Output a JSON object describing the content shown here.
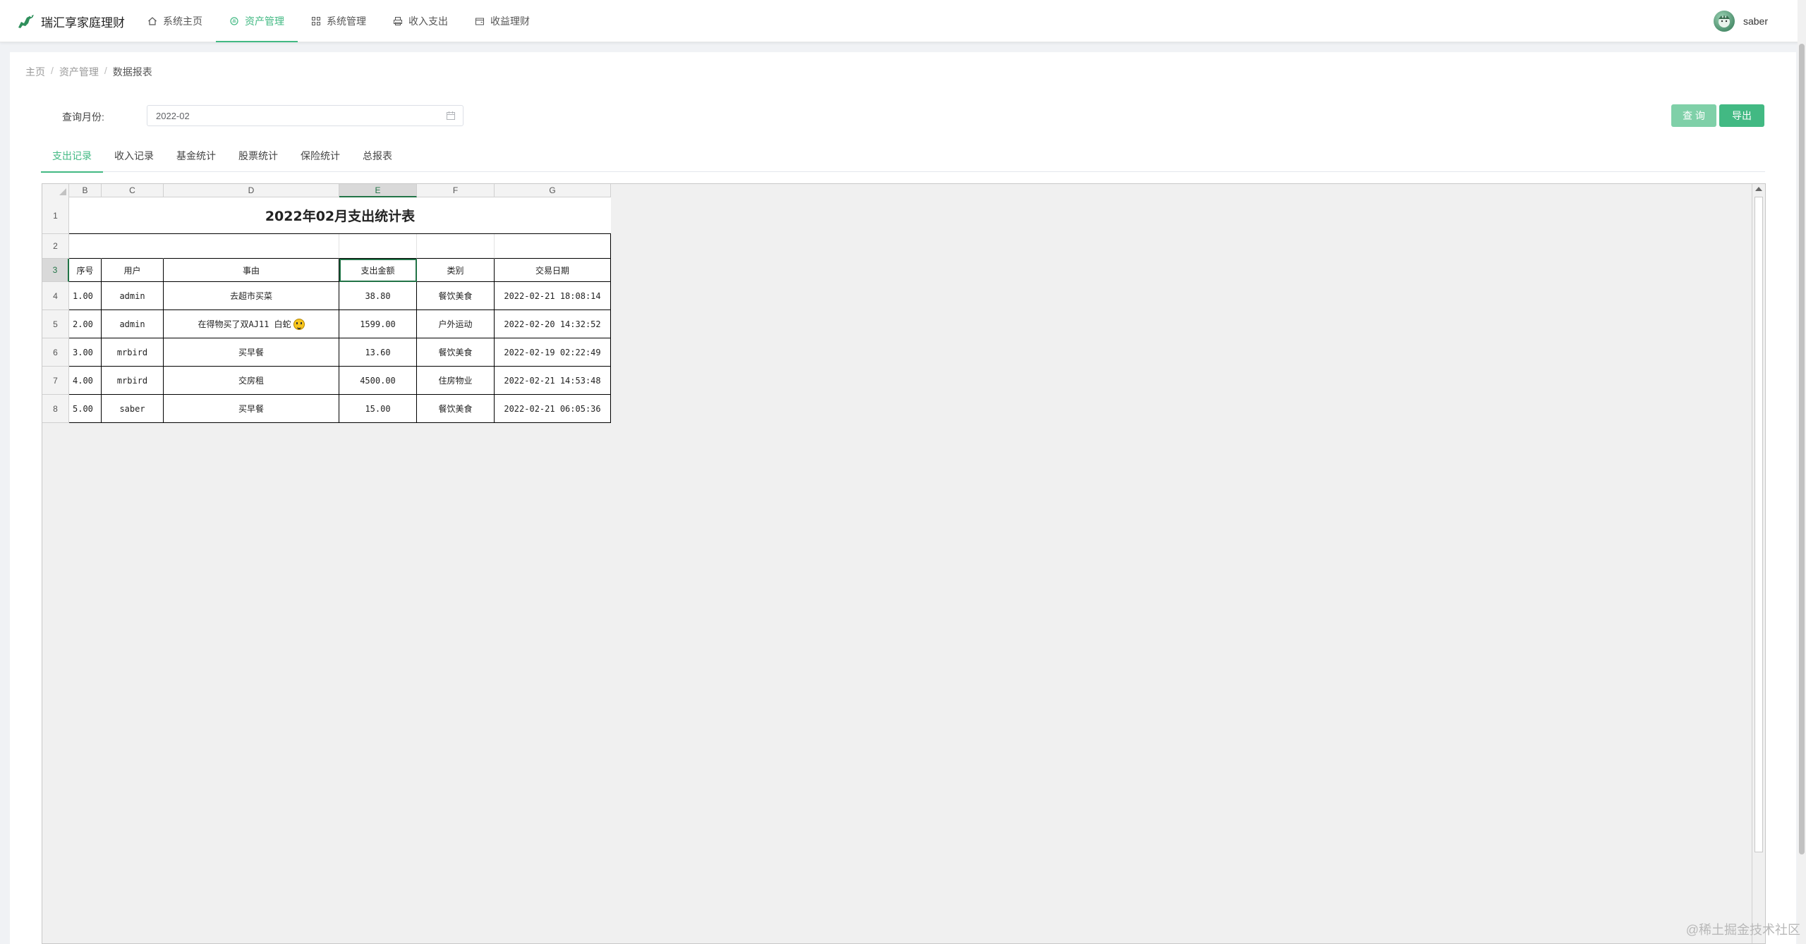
{
  "app": {
    "name": "瑞汇享家庭理财",
    "accent": "#42b983"
  },
  "nav": {
    "items": [
      {
        "label": "系统主页",
        "icon": "home-icon"
      },
      {
        "label": "资产管理",
        "icon": "asset-icon",
        "active": true
      },
      {
        "label": "系统管理",
        "icon": "grid-icon"
      },
      {
        "label": "收入支出",
        "icon": "printer-icon"
      },
      {
        "label": "收益理财",
        "icon": "wallet-icon"
      }
    ]
  },
  "user": {
    "name": "saber"
  },
  "breadcrumb": [
    "主页",
    "资产管理",
    "数据报表"
  ],
  "query": {
    "label": "查询月份:",
    "month": "2022-02",
    "query_button": "查 询",
    "export_button": "导出"
  },
  "tabs": [
    "支出记录",
    "收入记录",
    "基金统计",
    "股票统计",
    "保险统计",
    "总报表"
  ],
  "sheet": {
    "columns": [
      "B",
      "C",
      "D",
      "E",
      "F",
      "G"
    ],
    "selected_column": "E",
    "rows": [
      "1",
      "2",
      "3",
      "4",
      "5",
      "6",
      "7",
      "8"
    ],
    "selected_row": "3",
    "title": "2022年02月支出统计表",
    "headers": [
      "序号",
      "用户",
      "事由",
      "支出金额",
      "类别",
      "交易日期"
    ],
    "records": [
      [
        "1.00",
        "admin",
        "去超市买菜",
        "38.80",
        "餐饮美食",
        "2022-02-21 18:08:14"
      ],
      [
        "2.00",
        "admin",
        "在得物买了双AJ11 白蛇",
        "1599.00",
        "户外运动",
        "2022-02-20 14:32:52"
      ],
      [
        "3.00",
        "mrbird",
        "买早餐",
        "13.60",
        "餐饮美食",
        "2022-02-19 02:22:49"
      ],
      [
        "4.00",
        "mrbird",
        "交房租",
        "4500.00",
        "住房物业",
        "2022-02-21 14:53:48"
      ],
      [
        "5.00",
        "saber",
        "买早餐",
        "15.00",
        "餐饮美食",
        "2022-02-21 06:05:36"
      ]
    ]
  },
  "watermark": "@稀土掘金技术社区"
}
